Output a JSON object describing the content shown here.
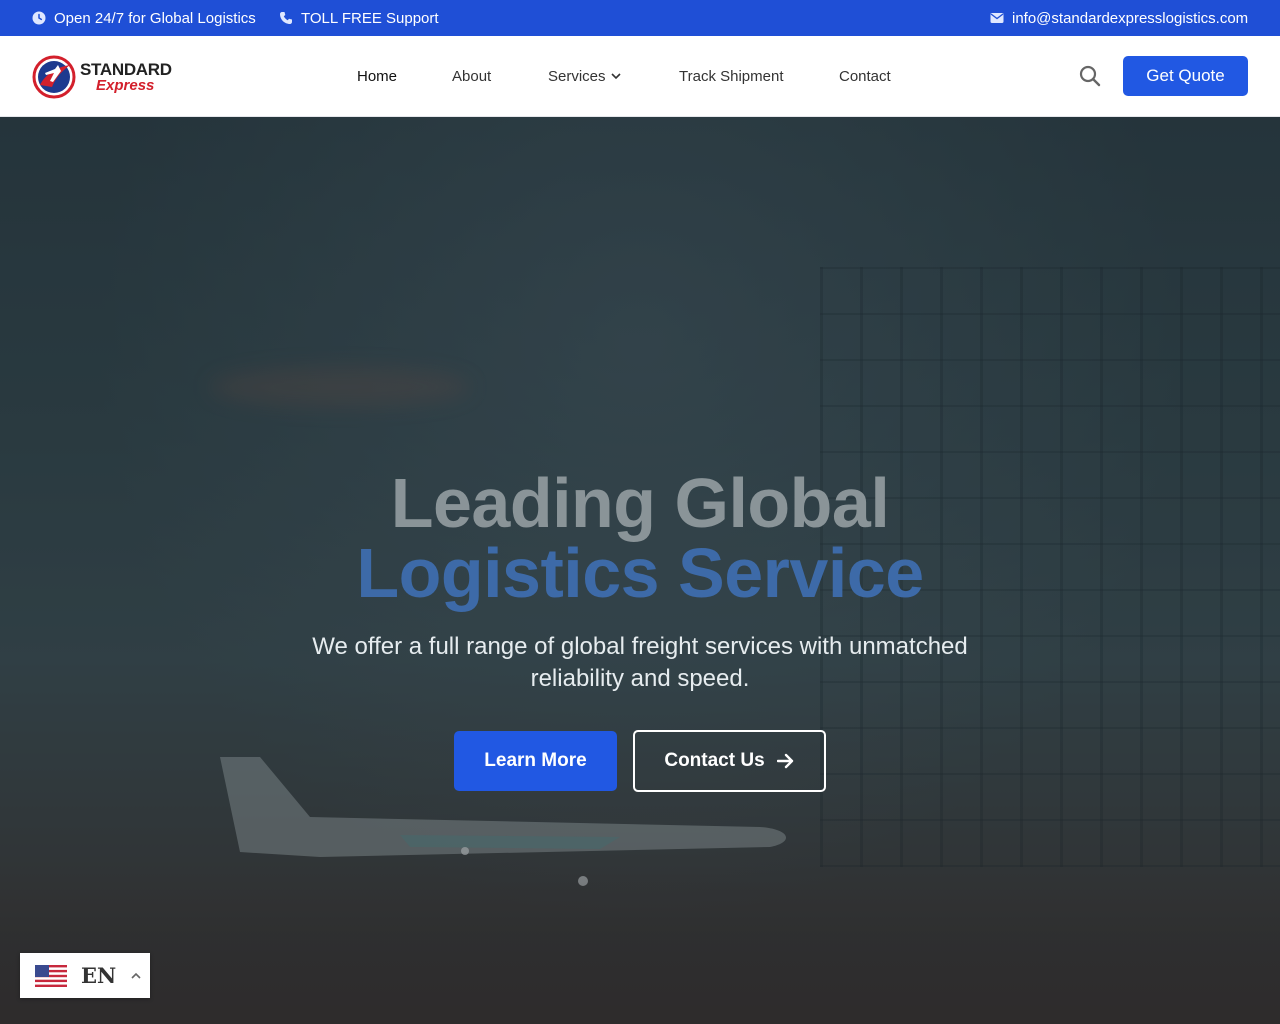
{
  "topbar": {
    "hours": "Open 24/7 for Global Logistics",
    "support": "TOLL FREE Support",
    "email": "info@standardexpresslogistics.com",
    "icons": [
      "clock-icon",
      "phone-icon",
      "mail-icon"
    ]
  },
  "brand": {
    "line1": "STANDARD",
    "line2": "Express"
  },
  "nav": {
    "items": [
      {
        "label": "Home"
      },
      {
        "label": "About"
      },
      {
        "label": "Services"
      },
      {
        "label": "Track Shipment"
      },
      {
        "label": "Contact"
      }
    ],
    "quote_label": "Get Quote"
  },
  "hero": {
    "title_line1": "Leading Global",
    "title_line2": "Logistics Service",
    "subtitle": "We offer a full range of global freight services with unmatched reliability and speed.",
    "primary_label": "Learn More",
    "secondary_label": "Contact Us"
  },
  "language": {
    "code": "EN"
  },
  "colors": {
    "accent": "#2158e3",
    "topbar": "#1f4fd6",
    "brand_red": "#d3202c"
  }
}
